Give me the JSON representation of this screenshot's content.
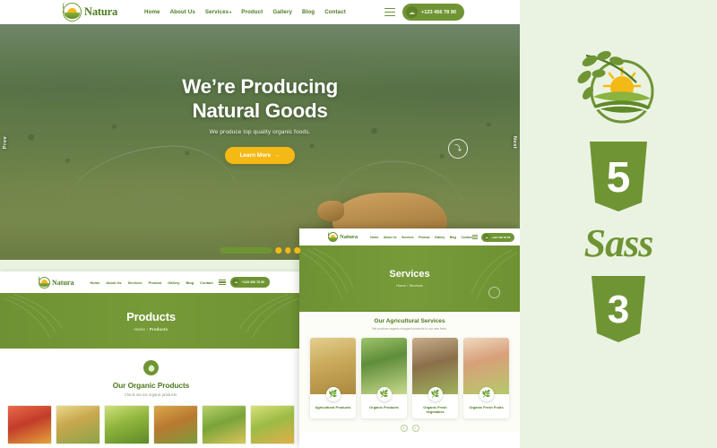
{
  "brand": {
    "name": "Natura",
    "logo_icon": "leaf-sun-farm-logo"
  },
  "nav": {
    "items": [
      {
        "label": "Home"
      },
      {
        "label": "About Us"
      },
      {
        "label": "Services",
        "caret": "▾"
      },
      {
        "label": "Product"
      },
      {
        "label": "Gallery"
      },
      {
        "label": "Blog"
      },
      {
        "label": "Contact"
      }
    ],
    "menu_icon": "hamburger-menu-icon",
    "phone_icon": "headset-support-icon",
    "phone": "+123 456 78 90"
  },
  "hero": {
    "title_line1": "We’re Producing",
    "title_line2": "Natural Goods",
    "subtitle": "We produce top quality organic foods.",
    "cta": "Learn More",
    "cta_arrow": "→",
    "prev_label": "Prev",
    "next_label": "Next",
    "scroll_icon": "scroll-down-chevron-icon",
    "dots": 3
  },
  "products_page": {
    "banner_title": "Products",
    "breadcrumb_home": "Home",
    "breadcrumb_sep": "›",
    "breadcrumb_current": "Products",
    "section_badge_icon": "organic-seal-icon",
    "section_title": "Our Organic Products",
    "section_subtitle": "Check out our organic products.",
    "thumbs": [
      {
        "alt": "tomatoes-crate"
      },
      {
        "alt": "mixed-vegetables"
      },
      {
        "alt": "corn-cobs"
      },
      {
        "alt": "farmer-with-basket"
      },
      {
        "alt": "green-peppers"
      },
      {
        "alt": "fresh-greens"
      }
    ]
  },
  "services_page": {
    "banner_title": "Services",
    "breadcrumb_home": "Home",
    "breadcrumb_sep": "›",
    "breadcrumb_current": "Services",
    "section_title": "Our Agricultural Services",
    "section_subtitle": "We produce organic chopped products in our own farm.",
    "cards": [
      {
        "title": "Agricultural Products",
        "icon": "wheat-leaf-icon",
        "image": "dried-corn-husks"
      },
      {
        "title": "Organic Products",
        "icon": "organic-leaf-icon",
        "image": "farmer-holding-vegetable-crate"
      },
      {
        "title": "Organic Fresh Vegetables",
        "icon": "vegetable-leaf-icon",
        "image": "farmer-harvesting-tomatoes"
      },
      {
        "title": "Organic Fresh Fruits",
        "icon": "fruit-leaf-icon",
        "image": "pineapple-and-fruits"
      }
    ],
    "pager_prev": "‹",
    "pager_next": "›"
  },
  "tech_badges": [
    {
      "name": "natura-logo-badge",
      "label": ""
    },
    {
      "name": "html5-badge",
      "label": "5"
    },
    {
      "name": "sass-badge",
      "label": "Sass"
    },
    {
      "name": "css3-badge",
      "label": "3"
    }
  ],
  "colors": {
    "primary_green": "#6f9434",
    "dark_green": "#4d7a1e",
    "accent_yellow": "#f5b916",
    "page_bg": "#eaf3e1"
  }
}
